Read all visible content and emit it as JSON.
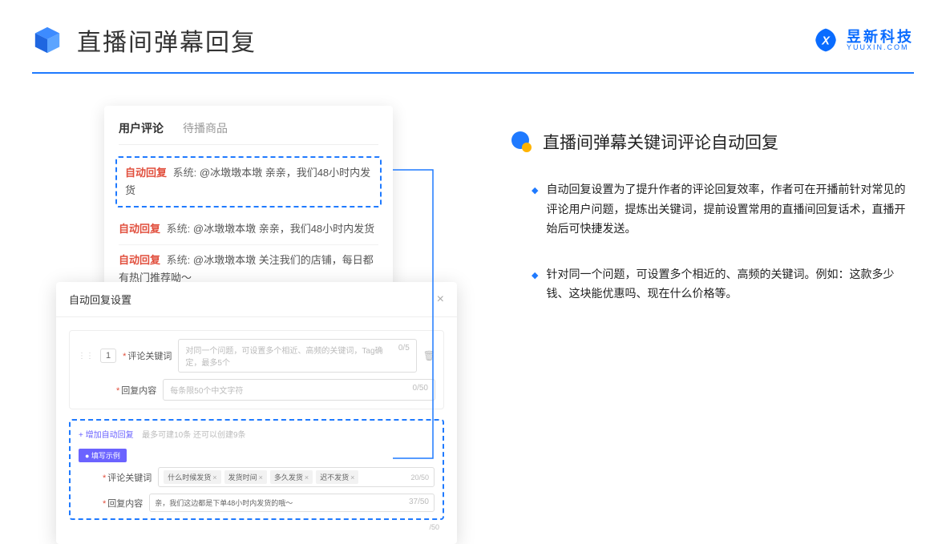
{
  "header": {
    "title": "直播间弹幕回复",
    "brand_cn": "昱新科技",
    "brand_en": "YUUXIN.COM"
  },
  "comment_card": {
    "tabs": [
      {
        "label": "用户评论",
        "active": true
      },
      {
        "label": "待播商品",
        "active": false
      }
    ],
    "comments": [
      {
        "auto": "自动回复",
        "sys": "系统:",
        "text": "@冰墩墩本墩 亲亲，我们48小时内发货",
        "highlighted": true
      },
      {
        "auto": "自动回复",
        "sys": "系统:",
        "text": "@冰墩墩本墩 亲亲，我们48小时内发货",
        "highlighted": false
      },
      {
        "auto": "自动回复",
        "sys": "系统:",
        "text": "@冰墩墩本墩 关注我们的店铺，每日都有热门推荐呦～",
        "highlighted": false
      }
    ]
  },
  "settings": {
    "title": "自动回复设置",
    "seq": "1",
    "keyword_label": "评论关键词",
    "keyword_placeholder": "对同一个问题，可设置多个相近、高频的关键词，Tag确定，最多5个",
    "keyword_counter": "0/5",
    "reply_label": "回复内容",
    "reply_placeholder": "每条限50个中文字符",
    "reply_counter": "0/50",
    "add_link": "+ 增加自动回复",
    "add_hint": "最多可建10条 还可以创建9条",
    "example_badge": "● 填写示例",
    "ex_keyword_label": "评论关键词",
    "ex_tags": [
      "什么时候发货",
      "发货时间",
      "多久发货",
      "迟不发货"
    ],
    "ex_keyword_counter": "20/50",
    "ex_reply_label": "回复内容",
    "ex_reply_text": "亲，我们这边都是下单48小时内发货的哦～",
    "ex_reply_counter": "37/50",
    "bottom_counter": "/50"
  },
  "right": {
    "section_title": "直播间弹幕关键词评论自动回复",
    "bullets": [
      "自动回复设置为了提升作者的评论回复效率，作者可在开播前针对常见的评论用户问题，提炼出关键词，提前设置常用的直播间回复话术，直播开始后可快捷发送。",
      "针对同一个问题，可设置多个相近的、高频的关键词。例如：这款多少钱、这块能优惠吗、现在什么价格等。"
    ]
  }
}
